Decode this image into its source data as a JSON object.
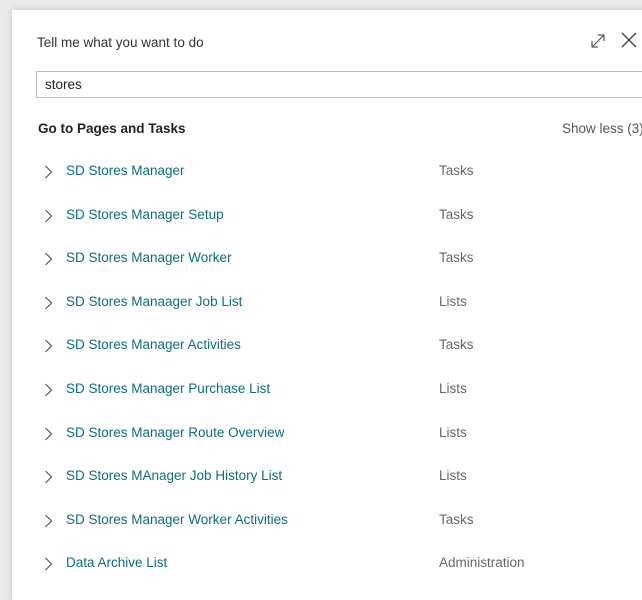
{
  "dialog": {
    "header": "Tell me what you want to do",
    "icons": {
      "expand": "expand-icon",
      "close": "close-icon"
    }
  },
  "search": {
    "value": "stores",
    "placeholder": ""
  },
  "section": {
    "title": "Go to Pages and Tasks",
    "toggle_label": "Show less (3)"
  },
  "results": [
    {
      "name": "SD Stores Manager",
      "category": "Tasks"
    },
    {
      "name": "SD Stores Manager Setup",
      "category": "Tasks"
    },
    {
      "name": "SD Stores Manager Worker",
      "category": "Tasks"
    },
    {
      "name": "SD Stores Manaager Job List",
      "category": "Lists"
    },
    {
      "name": "SD Stores Manager Activities",
      "category": "Tasks"
    },
    {
      "name": "SD Stores Manager Purchase List",
      "category": "Lists"
    },
    {
      "name": "SD Stores Manager Route Overview",
      "category": "Lists"
    },
    {
      "name": "SD Stores MAnager Job History List",
      "category": "Lists"
    },
    {
      "name": "SD Stores Manager Worker Activities",
      "category": "Tasks"
    },
    {
      "name": "Data Archive List",
      "category": "Administration"
    }
  ],
  "colors": {
    "link": "#0a6e7f",
    "category": "#666666",
    "background": "#ffffff"
  }
}
